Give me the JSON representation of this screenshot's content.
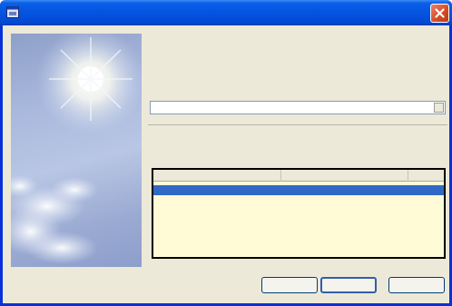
{
  "window": {
    "title": ""
  },
  "sections": {
    "current": {
      "heading": "",
      "description": "",
      "field_value": ""
    },
    "choose": {
      "heading": "",
      "description": ""
    }
  },
  "list": {
    "columns": [
      "",
      ""
    ],
    "rows": [
      {
        "name": "",
        "detail": "",
        "selected": true
      },
      {
        "name": "",
        "detail": "",
        "selected": false
      }
    ]
  },
  "buttons": {
    "back": "",
    "next": "",
    "cancel": ""
  },
  "colors": {
    "title_bar": "#0554e0",
    "selection": "#316ac5",
    "list_background": "#fffbd6",
    "dialog_face": "#ece9d8"
  },
  "icons": {
    "title": "window-app-icon",
    "close": "close-icon"
  }
}
